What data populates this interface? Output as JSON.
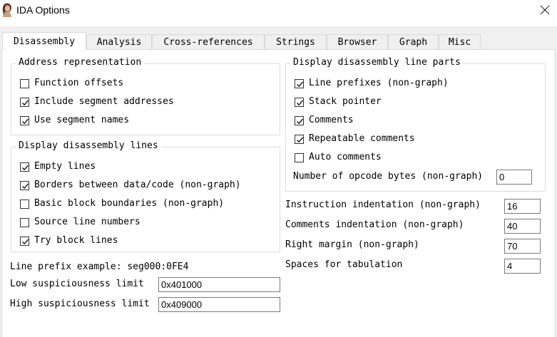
{
  "window": {
    "title": "IDA Options",
    "icon": "person-avatar-icon",
    "close_icon": "close-icon"
  },
  "tabs": [
    {
      "label": "Disassembly",
      "active": true
    },
    {
      "label": "Analysis",
      "active": false
    },
    {
      "label": "Cross-references",
      "active": false
    },
    {
      "label": "Strings",
      "active": false
    },
    {
      "label": "Browser",
      "active": false
    },
    {
      "label": "Graph",
      "active": false
    },
    {
      "label": "Misc",
      "active": false
    }
  ],
  "address_representation": {
    "legend": "Address representation",
    "items": [
      {
        "label": "Function offsets",
        "checked": false
      },
      {
        "label": "Include segment addresses",
        "checked": true
      },
      {
        "label": "Use segment names",
        "checked": true
      }
    ]
  },
  "display_lines": {
    "legend": "Display disassembly lines",
    "items": [
      {
        "label": "Empty lines",
        "checked": true
      },
      {
        "label": "Borders between data/code (non-graph)",
        "checked": true
      },
      {
        "label": "Basic block boundaries (non-graph)",
        "checked": false
      },
      {
        "label": "Source line numbers",
        "checked": false
      },
      {
        "label": "Try block lines",
        "checked": true
      }
    ]
  },
  "line_parts": {
    "legend": "Display disassembly line parts",
    "items": [
      {
        "label": "Line prefixes (non-graph)",
        "checked": true
      },
      {
        "label": "Stack pointer",
        "checked": true
      },
      {
        "label": "Comments",
        "checked": true
      },
      {
        "label": "Repeatable comments",
        "checked": true
      },
      {
        "label": "Auto comments",
        "checked": false
      }
    ],
    "opcode_label": "Number of opcode bytes (non-graph)",
    "opcode_value": "0"
  },
  "indentation": [
    {
      "label": "Instruction indentation (non-graph)",
      "value": "16"
    },
    {
      "label": "Comments indentation (non-graph)",
      "value": "40"
    },
    {
      "label": "Right margin (non-graph)",
      "value": "70"
    },
    {
      "label": "Spaces for tabulation",
      "value": "4"
    }
  ],
  "prefix_example": "Line prefix example: seg000:0FE4",
  "limits": [
    {
      "label": "Low suspiciousness limit",
      "value": "0x401000"
    },
    {
      "label": "High suspiciousness limit",
      "value": "0x409000"
    }
  ],
  "colors": {
    "border": "#dcdcdc",
    "background": "#f0f0f0",
    "panel": "#ffffff"
  }
}
